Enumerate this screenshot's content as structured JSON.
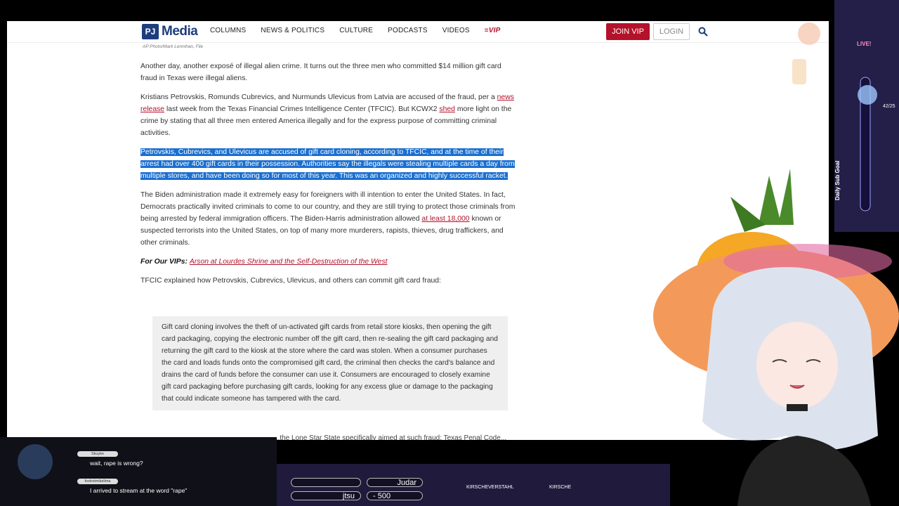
{
  "site": {
    "logo_pj": "PJ",
    "logo_media": "Media",
    "nav": [
      "COLUMNS",
      "NEWS & POLITICS",
      "CULTURE",
      "PODCASTS",
      "VIDEOS"
    ],
    "nav_vip": "≡VIP",
    "join_label": "JOIN VIP",
    "login_label": "LOGIN",
    "search_icon": "search-icon"
  },
  "article": {
    "photo_credit": "AP Photo/Mark Lennihan, File",
    "p1": "Another day, another exposé of illegal alien crime. It turns out the three men who committed $14 million gift card fraud in Texas were illegal aliens.",
    "p2_a": "Kristians Petrovskis, Romunds Cubrevics, and Nurmunds Ulevicus from Latvia are accused of the fraud, per a ",
    "p2_link1": "news release",
    "p2_b": " last week from the Texas Financial Crimes Intelligence Center (TFCIC). But KCWX2 ",
    "p2_link2": "shed",
    "p2_c": " more light on the crime by stating that all three men entered America illegally and for the express purpose of committing criminal activities.",
    "p3_highlighted": "Petrovskis, Cubrevics, and Ulevicus are accused of gift card cloning, according to TFCIC, and at the time of their arrest had over 400 gift cards in their possession. Authorities say the illegals were stealing multiple cards a day from multiple stores, and have been doing so for most of this year. This was an organized and highly successful racket.",
    "p4_a": "The Biden administration made it extremely easy for foreigners with ill intention to enter the United States. In fact, Democrats practically invited criminals to come to our country, and they are still trying to protect those criminals from being arrested by federal immigration officers. The Biden-Harris administration allowed ",
    "p4_link": "at least 18,000",
    "p4_b": " known or suspected terrorists into the United States, on top of many more murderers, rapists, thieves, drug traffickers, and other criminals.",
    "vip_label": "For Our VIPs:",
    "vip_link": "Arson at Lourdes Shrine and the Self-Destruction of the West",
    "p5": "TFCIC explained how Petrovskis, Cubrevics, Ulevicus, and others can commit gift card fraud:",
    "quote": "Gift card cloning involves the theft of un-activated gift cards from retail store kiosks, then opening the gift card packaging, copying the electronic number off the gift card, then re-sealing the gift card packaging and returning the gift card to the kiosk at the store where the card was stolen. When a consumer purchases the card and loads funds onto the compromised gift card, the criminal then checks the card's balance and drains the card of funds before the consumer can use it. Consumers are encouraged to closely examine gift card packaging before purchasing gift cards, looking for any excess glue or damage to the packaging that could indicate someone has tampered with the card.",
    "cut_line": "...the Lone Star State specifically aimed at such fraud: Texas Penal Code..."
  },
  "overlay": {
    "live_label": "LIVE!",
    "sub_goal_label": "Daily Sub Goal",
    "sub_goal_count": "42/25",
    "chat": [
      {
        "user": "Skuyke",
        "text": "wait, rape is wrong?"
      },
      {
        "user": "foxtrotmikelima",
        "text": "I arrived to stream at the word \"rape\""
      }
    ],
    "ticker_top": "Judar",
    "ticker_bottom_left": "jtsu",
    "ticker_bottom_value": "- 500",
    "tag1": "KIRSCHEVERSTAHL",
    "tag2": "KIRSCHE"
  },
  "colors": {
    "brand_blue": "#1d3d7c",
    "brand_red": "#b3122a",
    "highlight": "#1a6fd0"
  }
}
